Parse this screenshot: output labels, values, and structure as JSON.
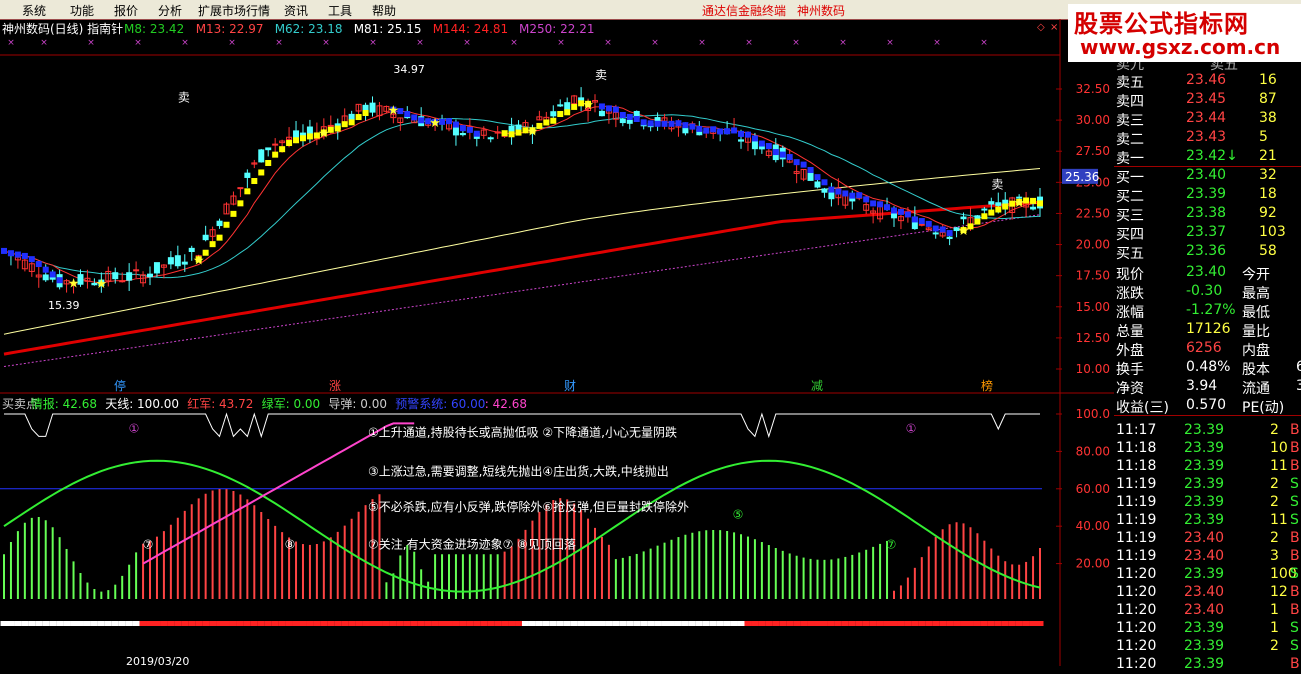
{
  "menu": {
    "items": [
      "系统",
      "功能",
      "报价",
      "分析",
      "扩展市场行情",
      "资讯",
      "工具",
      "帮助"
    ],
    "center_title": "通达信金融终端",
    "center_sub": "神州数码"
  },
  "watermark": {
    "line1": "股票公式指标网",
    "line2": "www.gsxz.com.cn"
  },
  "main_chart": {
    "title": "神州数码(日线) 指南针",
    "ma_labels": [
      {
        "text": "M8: 23.42",
        "color": "#22cc22"
      },
      {
        "text": "M13: 22.97",
        "color": "#ff4444"
      },
      {
        "text": "M62: 23.18",
        "color": "#33cccc"
      },
      {
        "text": "M81: 25.15",
        "color": "#ffffff"
      },
      {
        "text": "M144: 24.81",
        "color": "#ff2222"
      },
      {
        "text": "M250: 22.21",
        "color": "#cc44cc"
      }
    ],
    "y_ticks": [
      "32.50",
      "30.00",
      "27.50",
      "25.00",
      "22.50",
      "20.00",
      "17.50",
      "15.00",
      "12.50",
      "10.00"
    ],
    "y_min": 10.0,
    "y_max": 32.5,
    "current_price_tag": "25.36",
    "high_label": "34.97",
    "low_label": "15.39",
    "sell_label": "卖",
    "bottom_marks": [
      {
        "text": "停",
        "color": "#3399ff"
      },
      {
        "text": "涨",
        "color": "#ff4444"
      },
      {
        "text": "财",
        "color": "#3399ff"
      },
      {
        "text": "减",
        "color": "#33cc33"
      },
      {
        "text": "榜",
        "color": "#ff9900"
      }
    ],
    "colors": {
      "up": "#ff3232",
      "down": "#54ffff",
      "ma8": "#ffff00",
      "ma13": "#ff3333",
      "ma62": "#33cccc",
      "ma81": "#ffffa0",
      "ma144": "#e00000",
      "ma250": "#cc44cc",
      "band_blue": "#2030ff",
      "band_yellow": "#ffff00"
    }
  },
  "indicator": {
    "labels": [
      {
        "text": "买卖点",
        "color": "#cccccc"
      },
      {
        "text": "情报: 42.68",
        "color": "#33ee33"
      },
      {
        "text": "天线: 100.00",
        "color": "#ffffff"
      },
      {
        "text": "红军: 43.72",
        "color": "#ff4444"
      },
      {
        "text": "绿军: 0.00",
        "color": "#33ee33"
      },
      {
        "text": "导弹: 0.00",
        "color": "#cccccc"
      },
      {
        "text": "预警系统: 60.00",
        "color": "#3344ff"
      },
      {
        "text": ": 42.68",
        "color": "#ff44cc"
      }
    ],
    "y_ticks": [
      "100.0",
      "80.00",
      "60.00",
      "40.00",
      "20.00"
    ],
    "notes": [
      "①上升通道,持股待长或高抛低吸 ②下降通道,小心无量阴跌",
      "③上涨过急,需要调整,短线先抛出④庄出货,大跌,中线抛出",
      "⑤不必杀跌,应有小反弹,跌停除外⑥抢反弹,但巨量封跌停除外",
      "⑦关注,有大资金进场迹象⑦   ⑧见顶回落"
    ],
    "markers": {
      "one": "①",
      "five": "⑤",
      "seven": "⑦",
      "eight": "⑧"
    },
    "date_label": "2019/03/20"
  },
  "quote": {
    "book": [
      {
        "label": "卖五",
        "price": "23.46",
        "vol": "16",
        "pcolor": "#ff4444"
      },
      {
        "label": "卖四",
        "price": "23.45",
        "vol": "87",
        "pcolor": "#ff4444"
      },
      {
        "label": "卖三",
        "price": "23.44",
        "vol": "38",
        "pcolor": "#ff4444"
      },
      {
        "label": "卖二",
        "price": "23.43",
        "vol": "5",
        "pcolor": "#ff4444"
      },
      {
        "label": "卖一",
        "price": "23.42↓",
        "vol": "21",
        "pcolor": "#33ee33"
      },
      {
        "label": "买一",
        "price": "23.40",
        "vol": "32",
        "pcolor": "#33ee33"
      },
      {
        "label": "买二",
        "price": "23.39",
        "vol": "18",
        "pcolor": "#33ee33"
      },
      {
        "label": "买三",
        "price": "23.38",
        "vol": "92",
        "pcolor": "#33ee33"
      },
      {
        "label": "买四",
        "price": "23.37",
        "vol": "103",
        "pcolor": "#33ee33"
      },
      {
        "label": "买五",
        "price": "23.36",
        "vol": "58",
        "pcolor": "#33ee33"
      }
    ],
    "top_partial_left": "卖九",
    "top_partial_right": "卖五",
    "stats": [
      {
        "l": "现价",
        "v": "23.40",
        "vc": "#33ee33",
        "r": "今开"
      },
      {
        "l": "涨跌",
        "v": "-0.30",
        "vc": "#33ee33",
        "r": "最高"
      },
      {
        "l": "涨幅",
        "v": "-1.27%",
        "vc": "#33ee33",
        "r": "最低"
      },
      {
        "l": "总量",
        "v": "17126",
        "vc": "#ffff44",
        "r": "量比"
      },
      {
        "l": "外盘",
        "v": "6256",
        "vc": "#ff4444",
        "r": "内盘"
      },
      {
        "l": "换手",
        "v": "0.48%",
        "vc": "#ffffff",
        "r": "股本",
        "rv": "6"
      },
      {
        "l": "净资",
        "v": "3.94",
        "vc": "#ffffff",
        "r": "流通",
        "rv": "3"
      },
      {
        "l": "收益(三)",
        "v": "0.570",
        "vc": "#ffffff",
        "r": "PE(动)"
      }
    ],
    "ticks": [
      {
        "t": "11:17",
        "p": "23.39",
        "v": "2",
        "s": "B"
      },
      {
        "t": "11:18",
        "p": "23.39",
        "v": "10",
        "s": "B"
      },
      {
        "t": "11:18",
        "p": "23.39",
        "v": "11",
        "s": "B"
      },
      {
        "t": "11:19",
        "p": "23.39",
        "v": "2",
        "s": "S"
      },
      {
        "t": "11:19",
        "p": "23.39",
        "v": "2",
        "s": "S"
      },
      {
        "t": "11:19",
        "p": "23.39",
        "v": "11",
        "s": "S"
      },
      {
        "t": "11:19",
        "p": "23.40",
        "v": "2",
        "s": "B"
      },
      {
        "t": "11:19",
        "p": "23.40",
        "v": "3",
        "s": "B"
      },
      {
        "t": "11:20",
        "p": "23.39",
        "v": "100",
        "s": "S"
      },
      {
        "t": "11:20",
        "p": "23.40",
        "v": "12",
        "s": "B"
      },
      {
        "t": "11:20",
        "p": "23.40",
        "v": "1",
        "s": "B"
      },
      {
        "t": "11:20",
        "p": "23.39",
        "v": "1",
        "s": "S"
      },
      {
        "t": "11:20",
        "p": "23.39",
        "v": "2",
        "s": "S"
      },
      {
        "t": "11:20",
        "p": "23.39",
        "v": "",
        "s": "B"
      }
    ]
  }
}
